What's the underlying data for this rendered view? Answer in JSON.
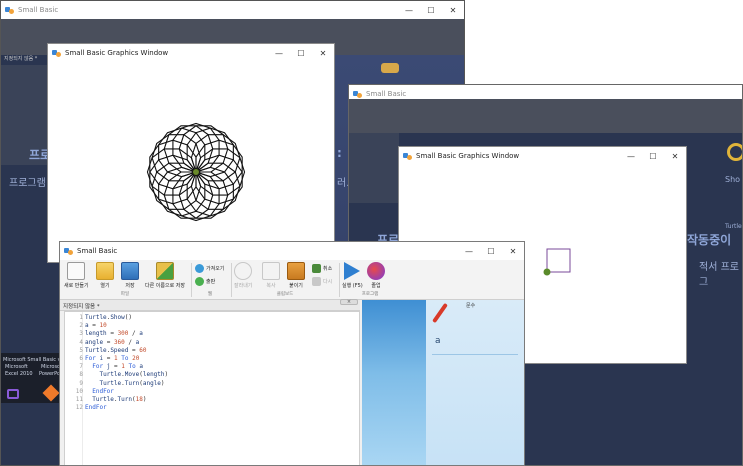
{
  "windows": {
    "bg_app_title": "Small Basic",
    "bg_app2_title": "Small Basic",
    "graphics1_title": "Small Basic Graphics Window",
    "graphics2_title": "Small Basic Graphics Window",
    "main_title": "Small Basic"
  },
  "controls": {
    "minimize": "—",
    "maximize": "☐",
    "close": "✕"
  },
  "background_text": {
    "tab": "지정되지 않음 *",
    "big1": "프로",
    "small1": "프로그램",
    "small1_right": "러.",
    "big2": "프로",
    "big2_right": "작동중이",
    "small2_right": "적서 프로그",
    "logo_text": "Sho",
    "side_text": "Turtle",
    "taskbar_line1": "Microsoft Small Basic v1.",
    "taskbar_line2a": "Microsoft",
    "taskbar_line2b": "Microso",
    "taskbar_line3a": "Excel 2010",
    "taskbar_line3b": "PowerPo"
  },
  "ribbon": {
    "new": "새로 만들기",
    "open": "열기",
    "save": "저장",
    "save_as": "다른 이름으로 저장",
    "group_file": "파일",
    "import": "가져오기",
    "publish": "출판",
    "group_web": "웹",
    "cut": "잘라내기",
    "copy": "복사",
    "paste": "붙이기",
    "undo": "취소",
    "redo": "다시",
    "group_clipboard": "클립보드",
    "run": "실행 (F5)",
    "end": "졸업",
    "group_program": "프로그램"
  },
  "doc_tab": "지정되지 않음 *",
  "tab_close": "×",
  "code_lines": [
    {
      "n": "1",
      "t": "Turtle.Show()"
    },
    {
      "n": "2",
      "t": "a = 10"
    },
    {
      "n": "3",
      "t": "length = 300 / a"
    },
    {
      "n": "4",
      "t": "angle = 360 / a"
    },
    {
      "n": "5",
      "t": "Turtle.Speed = 60"
    },
    {
      "n": "6",
      "t": "For i = 1 To 20"
    },
    {
      "n": "7",
      "t": "  For j = 1 To a"
    },
    {
      "n": "8",
      "t": "    Turtle.Move(length)"
    },
    {
      "n": "9",
      "t": "    Turtle.Turn(angle)"
    },
    {
      "n": "10",
      "t": "  EndFor"
    },
    {
      "n": "11",
      "t": "  Turtle.Turn(18)"
    },
    {
      "n": "12",
      "t": "EndFor"
    }
  ],
  "side_panel": {
    "label": "문수",
    "name": "a"
  },
  "colors": {
    "background_app": "#2a3550",
    "keyword": "#2a5bd7",
    "number": "#c24a2a",
    "accent": "#3f8fd3"
  }
}
